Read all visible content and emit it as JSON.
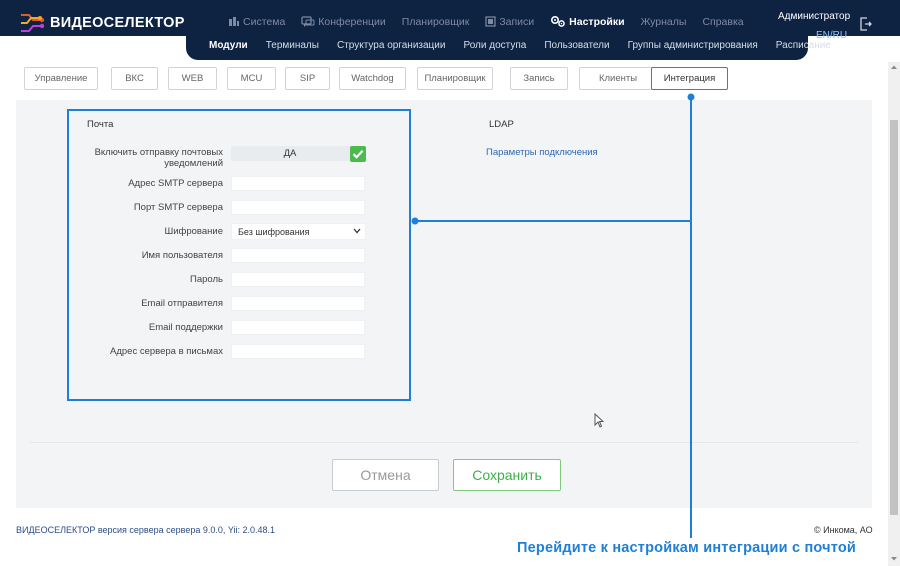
{
  "brand": {
    "name": "ВИДЕОСЕЛЕКТОР"
  },
  "topnav": [
    {
      "label": "Система",
      "icon": "system-icon",
      "active": false
    },
    {
      "label": "Конференции",
      "icon": "chat-icon",
      "active": false
    },
    {
      "label": "Планировщик",
      "icon": "",
      "active": false
    },
    {
      "label": "Записи",
      "icon": "recordings-icon",
      "active": false
    },
    {
      "label": "Настройки",
      "icon": "gear-icon",
      "active": true
    },
    {
      "label": "Журналы",
      "icon": "",
      "active": false
    },
    {
      "label": "Справка",
      "icon": "",
      "active": false
    }
  ],
  "user": {
    "name": "Администратор",
    "lang": "EN/RU"
  },
  "subnav": [
    {
      "label": "Модули",
      "active": true
    },
    {
      "label": "Терминалы",
      "active": false
    },
    {
      "label": "Структура организации",
      "active": false
    },
    {
      "label": "Роли доступа",
      "active": false
    },
    {
      "label": "Пользователи",
      "active": false
    },
    {
      "label": "Группы администрирования",
      "active": false
    },
    {
      "label": "Расписание",
      "active": false
    }
  ],
  "tabs": [
    {
      "label": "Управление",
      "active": false
    },
    {
      "label": "ВКС",
      "active": false
    },
    {
      "label": "WEB",
      "active": false
    },
    {
      "label": "MCU",
      "active": false
    },
    {
      "label": "SIP",
      "active": false
    },
    {
      "label": "Watchdog",
      "active": false
    },
    {
      "label": "Планировщик",
      "active": false
    },
    {
      "label": "Запись",
      "active": false
    },
    {
      "label": "Клиенты",
      "active": false
    },
    {
      "label": "Интеграция",
      "active": true
    }
  ],
  "mail": {
    "title": "Почта",
    "enable_label_line1": "Включить отправку почтовых",
    "enable_label_line2": "уведомлений",
    "enable_value": "ДА",
    "smtp_server_label": "Адрес SMTP сервера",
    "smtp_port_label": "Порт SMTP сервера",
    "encryption_label": "Шифрование",
    "encryption_value": "Без шифрования",
    "username_label": "Имя пользователя",
    "password_label": "Пароль",
    "sender_email_label": "Email отправителя",
    "support_email_label": "Email поддержки",
    "server_address_label": "Адрес сервера в письмах"
  },
  "ldap": {
    "title": "LDAP",
    "link": "Параметры подключения"
  },
  "buttons": {
    "cancel": "Отмена",
    "save": "Сохранить"
  },
  "footer": {
    "version": "ВИДЕОСЕЛЕКТОР версия сервера сервера 9.0.0, Yii: 2.0.48.1",
    "copyright": "© Инкома, АО"
  },
  "callout": {
    "text": "Перейдите к настройкам интеграции с почтой"
  },
  "colors": {
    "header_bg": "#0e2241",
    "accent": "#1f7fd8",
    "save_green": "#3fae49",
    "check_green": "#4cbb4e"
  }
}
